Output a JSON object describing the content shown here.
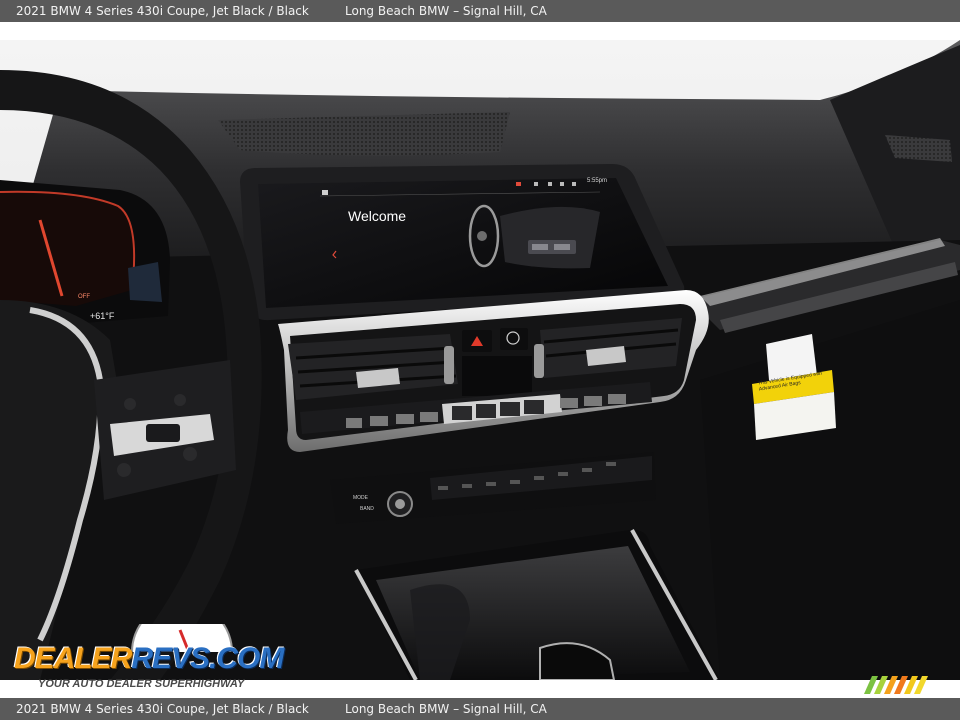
{
  "caption": {
    "vehicle": "2021 BMW 4 Series 430i Coupe,  Jet Black / Black",
    "dealer": "Long Beach BMW – Signal Hill, CA"
  },
  "screen": {
    "welcome": "Welcome",
    "clock": "5:55pm"
  },
  "cluster": {
    "outside_temp": "+61°F",
    "status": "OFF"
  },
  "radio": {
    "mode": "MODE",
    "band": "BAND"
  },
  "sticker": {
    "text": "This Vehicle is Equipped with Advanced Air Bags"
  },
  "watermark": {
    "logo_part1": "DEALER",
    "logo_part2": "REVS",
    "logo_part3": ".COM",
    "tagline": "YOUR AUTO DEALER SUPERHIGHWAY"
  },
  "colors": {
    "caption_bar": "#5a5a5a",
    "logo_orange": "#f6a21c",
    "logo_blue": "#2a6fc2"
  }
}
